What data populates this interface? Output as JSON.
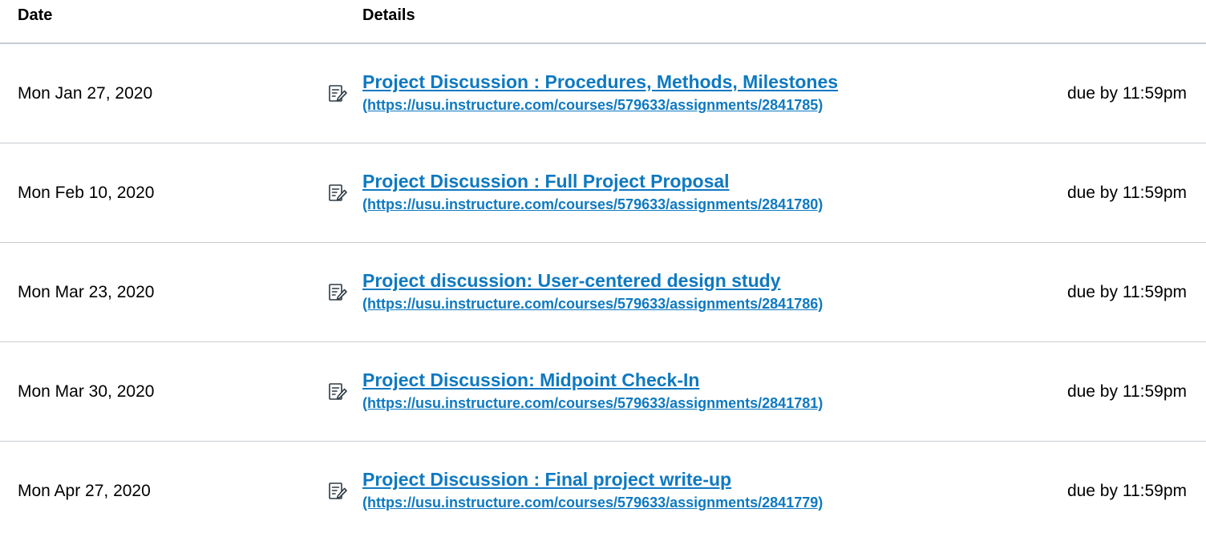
{
  "table": {
    "header": {
      "date": "Date",
      "details": "Details"
    },
    "rows": [
      {
        "date": "Mon Jan 27, 2020",
        "icon": "assignment-edit-icon",
        "title": "Project Discussion : Procedures, Methods, Milestones",
        "url": "(https://usu.instructure.com/courses/579633/assignments/2841785)",
        "due": "due by 11:59pm"
      },
      {
        "date": "Mon Feb 10, 2020",
        "icon": "assignment-edit-icon",
        "title": "Project Discussion : Full Project Proposal",
        "url": "(https://usu.instructure.com/courses/579633/assignments/2841780)",
        "due": "due by 11:59pm"
      },
      {
        "date": "Mon Mar 23, 2020",
        "icon": "assignment-edit-icon",
        "title": "Project discussion: User-centered design study",
        "url": "(https://usu.instructure.com/courses/579633/assignments/2841786)",
        "due": "due by 11:59pm"
      },
      {
        "date": "Mon Mar 30, 2020",
        "icon": "assignment-edit-icon",
        "title": "Project Discussion: Midpoint Check-In",
        "url": "(https://usu.instructure.com/courses/579633/assignments/2841781)",
        "due": "due by 11:59pm"
      },
      {
        "date": "Mon Apr 27, 2020",
        "icon": "assignment-edit-icon",
        "title": "Project Discussion : Final project write-up",
        "url": "(https://usu.instructure.com/courses/579633/assignments/2841779)",
        "due": "due by 11:59pm"
      }
    ]
  },
  "colors": {
    "link": "#0e79c1",
    "text": "#000000",
    "divider": "#c7cdd1"
  }
}
